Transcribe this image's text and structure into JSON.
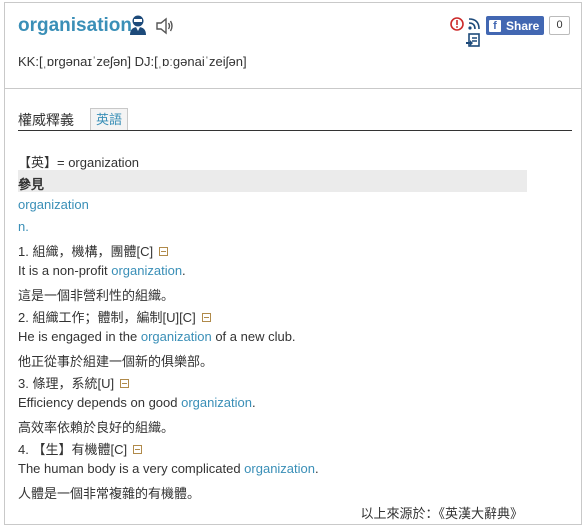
{
  "header": {
    "word": "organisation",
    "phonetic": "KK:[ˌɒrgənaɪˈzeʃən] DJ:[ˌɒːgənaiˈzeiʃən]",
    "share_label": "Share",
    "fb_letter": "f",
    "share_count": "0"
  },
  "tabs": {
    "authority": "權威釋義",
    "english": "英語"
  },
  "entry": {
    "english_def": "【英】= organization",
    "see_also_label": "參見",
    "see_also_link": "organization",
    "pos": "n.",
    "senses": [
      {
        "label": "1. 組織，機構，團體[C]",
        "example_before": "It is a non-profit ",
        "example_link": "organization",
        "example_after": ".",
        "translation": "這是一個非營利性的組織。"
      },
      {
        "label": "2. 組織工作；體制，編制[U][C]",
        "example_before": "He is engaged in the ",
        "example_link": "organization",
        "example_after": " of a new club.",
        "translation": "他正從事於組建一個新的俱樂部。"
      },
      {
        "label": "3. 條理，系統[U]",
        "example_before": "Efficiency depends on good ",
        "example_link": "organization",
        "example_after": ".",
        "translation": "高效率依賴於良好的組織。"
      },
      {
        "label": "4. 【生】有機體[C]",
        "example_before": "The human body is a very complicated ",
        "example_link": "organization",
        "example_after": ".",
        "translation": "人體是一個非常複雜的有機體。"
      }
    ],
    "source": "以上來源於：《英漢大辭典》"
  }
}
